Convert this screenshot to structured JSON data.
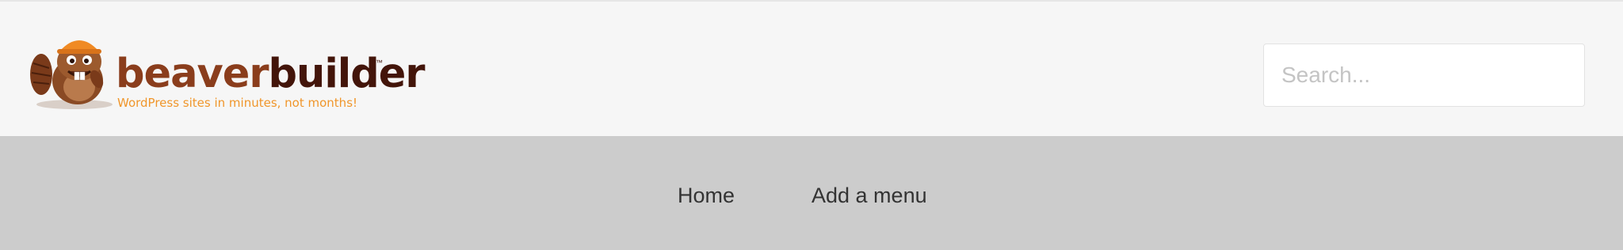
{
  "header": {
    "logo": {
      "word_light": "beaver",
      "word_dark": "builder",
      "trademark": "™",
      "tagline": "WordPress sites in minutes, not months!",
      "icon": "beaver-mascot-icon"
    },
    "search": {
      "placeholder": "Search..."
    }
  },
  "nav": {
    "items": [
      {
        "label": "Home"
      },
      {
        "label": "Add a menu"
      }
    ]
  },
  "colors": {
    "header_bg": "#f6f6f6",
    "nav_bg": "#cccccc",
    "brand_light": "#8a3d1c",
    "brand_dark": "#43150a",
    "tagline": "#f0962b"
  }
}
